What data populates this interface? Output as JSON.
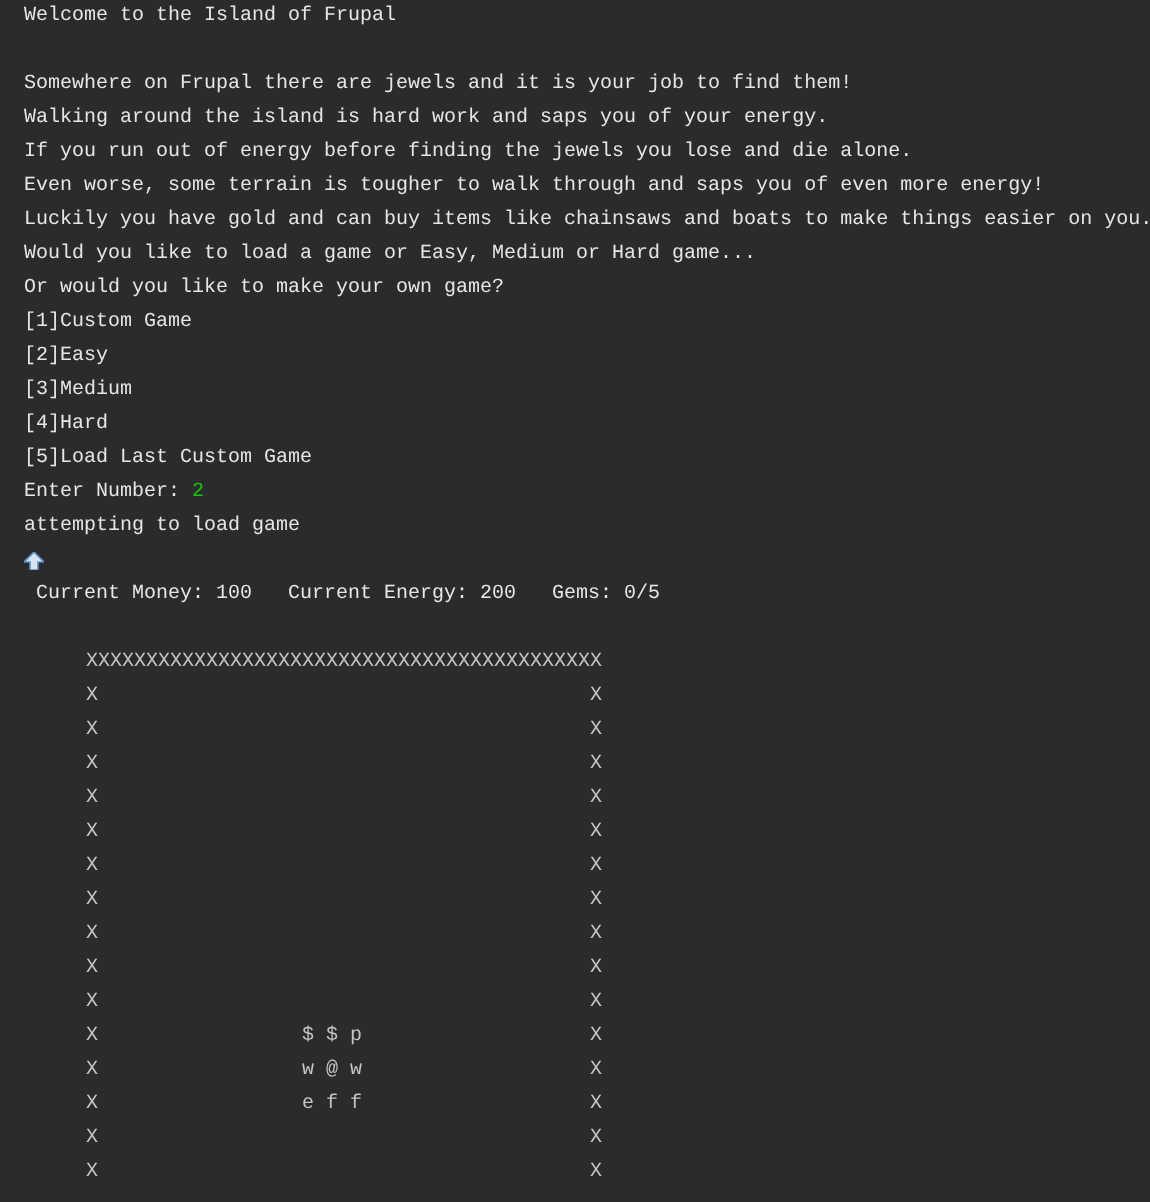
{
  "title": "Welcome to the Island of Frupal",
  "intro_lines": [
    "Somewhere on Frupal there are jewels and it is your job to find them!",
    "Walking around the island is hard work and saps you of your energy.",
    "If you run out of energy before finding the jewels you lose and die alone.",
    "Even worse, some terrain is tougher to walk through and saps you of even more energy!",
    "Luckily you have gold and can buy items like chainsaws and boats to make things easier on you.",
    "Would you like to load a game or Easy, Medium or Hard game...",
    "Or would you like to make your own game?"
  ],
  "menu_options": [
    "[1]Custom Game",
    "[2]Easy",
    "[3]Medium",
    "[4]Hard",
    "[5]Load Last Custom Game"
  ],
  "prompt": {
    "label": "Enter Number:",
    "value": "2"
  },
  "message": "attempting to load game",
  "status": "Current Money: 100   Current Energy: 200   Gems: 0/5",
  "map_rows": [
    "XXXXXXXXXXXXXXXXXXXXXXXXXXXXXXXXXXXXXXXXXXX",
    "X                                         X",
    "X                                         X",
    "X                                         X",
    "X                                         X",
    "X                                         X",
    "X                                         X",
    "X                                         X",
    "X                                         X",
    "X                                         X",
    "X                                         X",
    "X                 $ $ p                   X",
    "X                 w @ w                   X",
    "X                 e f f                   X",
    "X                                         X",
    "X                                         X"
  ]
}
